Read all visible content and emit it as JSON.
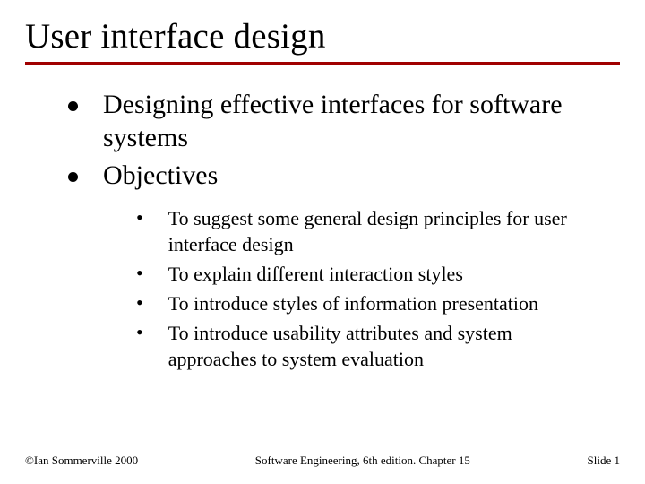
{
  "title": "User interface design",
  "body": {
    "items": [
      {
        "text": "Designing effective interfaces for software systems"
      },
      {
        "text": "Objectives"
      }
    ],
    "subitems": [
      {
        "text": "To suggest some general design principles for user interface design"
      },
      {
        "text": "To explain different interaction styles"
      },
      {
        "text": "To introduce styles of information presentation"
      },
      {
        "text": "To introduce usability attributes and system approaches to system evaluation"
      }
    ]
  },
  "footer": {
    "left": "©Ian Sommerville 2000",
    "center": "Software Engineering, 6th edition. Chapter 15",
    "right": "Slide 1"
  }
}
